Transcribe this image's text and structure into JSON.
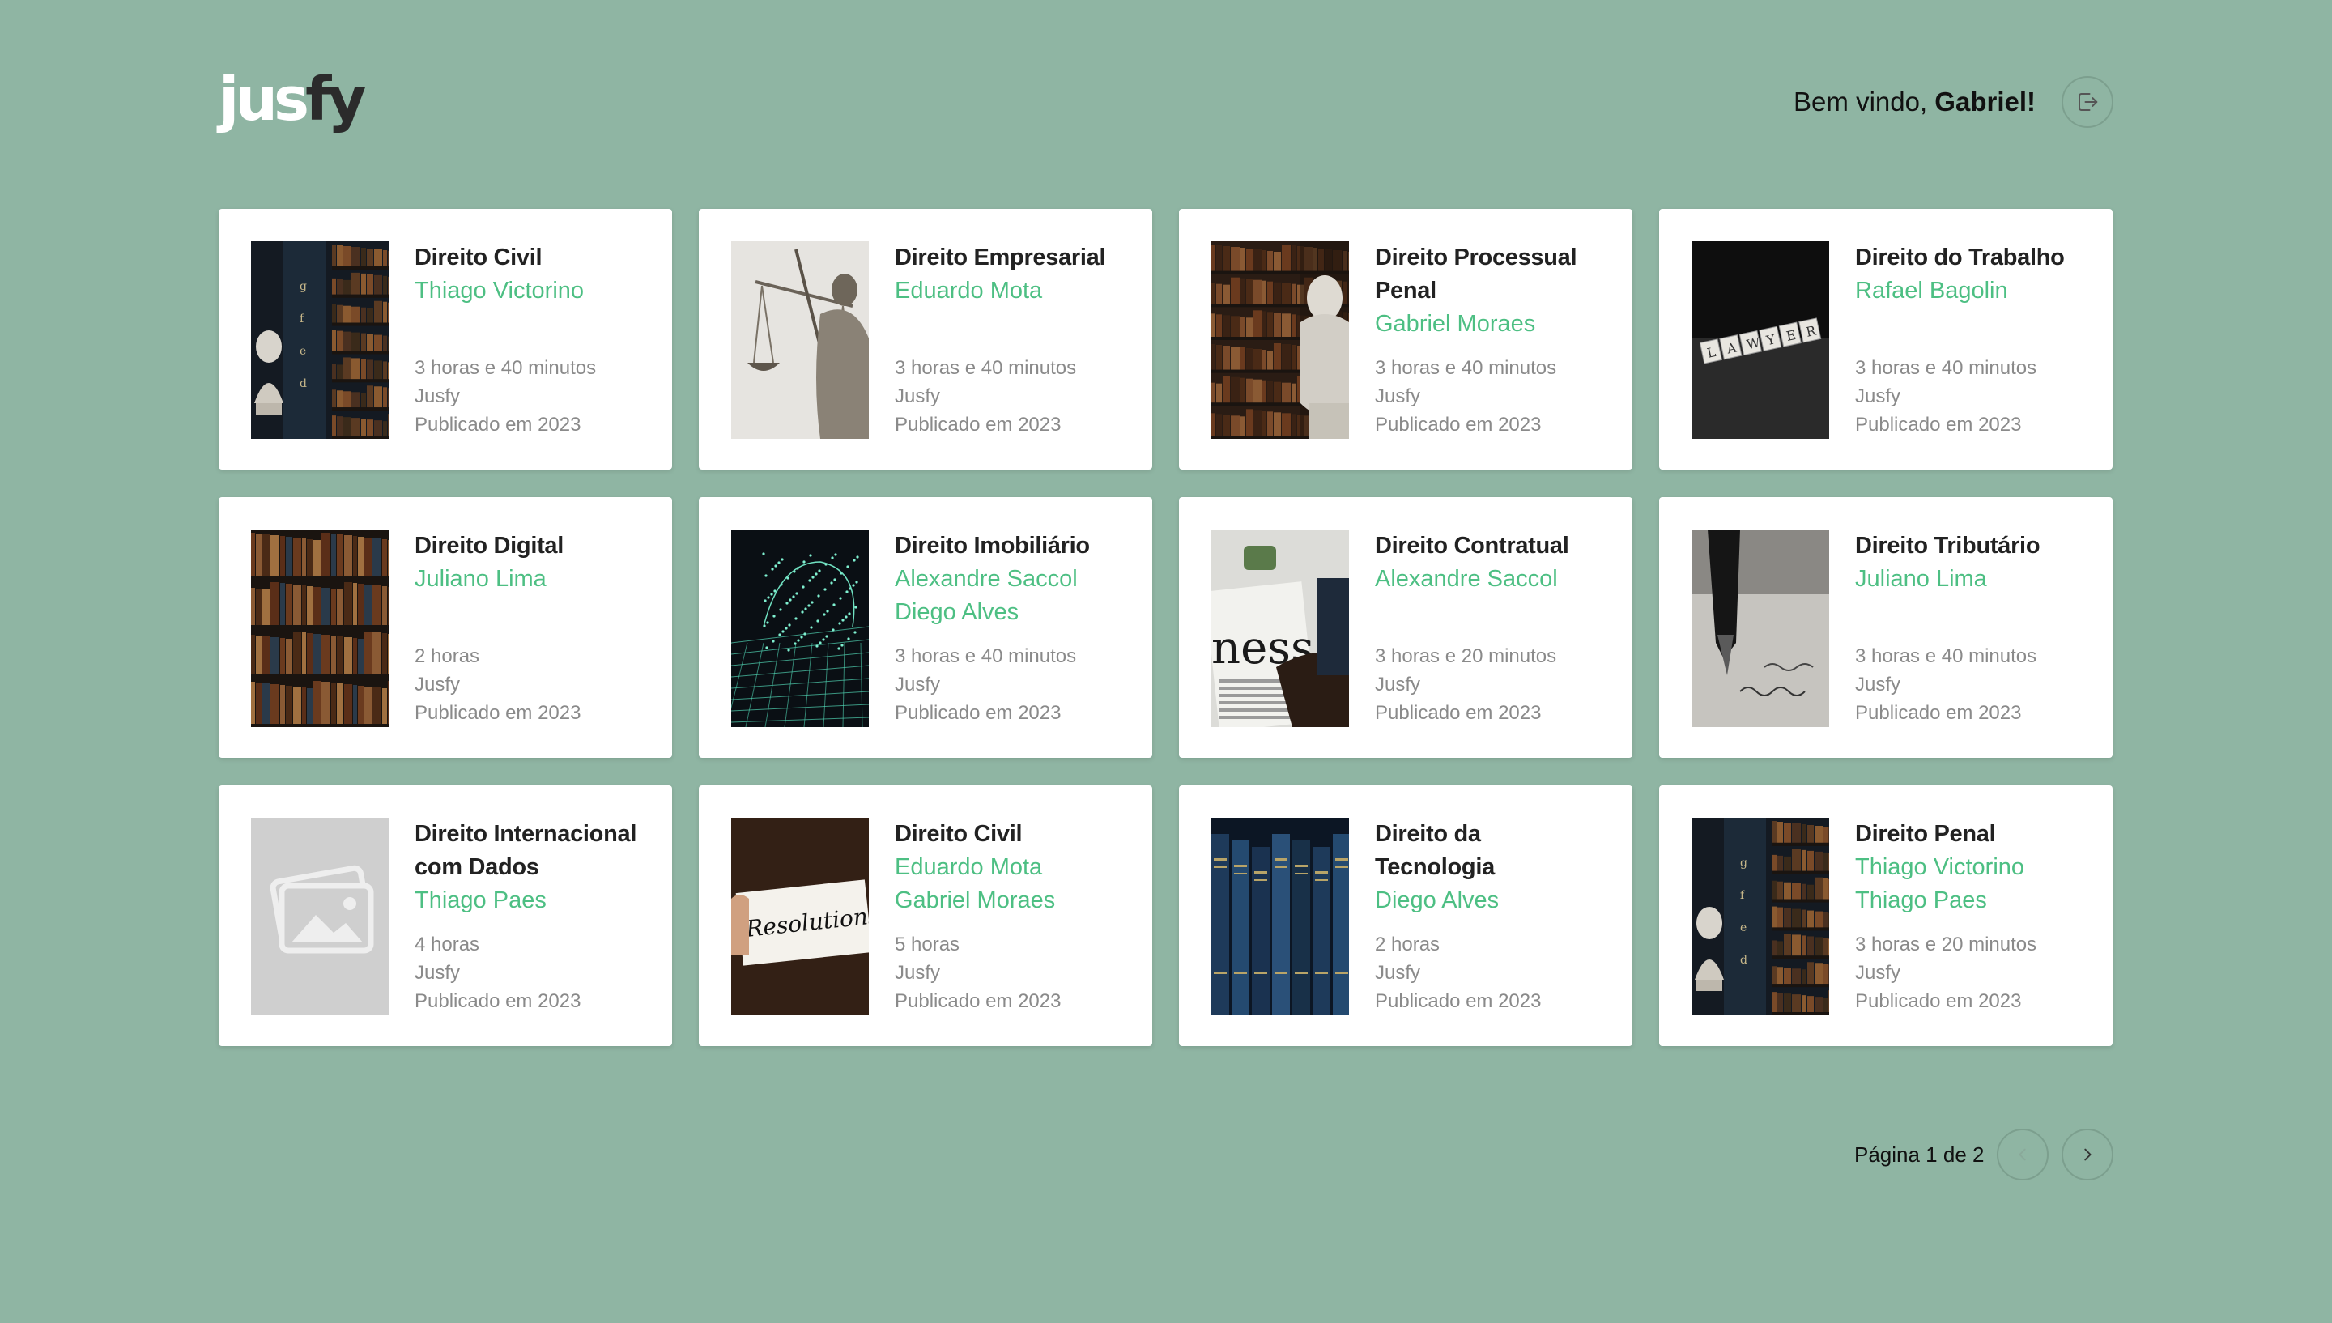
{
  "header": {
    "logo_part1": "jus",
    "logo_part2": "fy",
    "welcome_prefix": "Bem vindo, ",
    "user_name": "Gabriel!",
    "logout_icon": "logout-icon"
  },
  "courses": [
    {
      "title": "Direito Civil",
      "authors": [
        "Thiago Victorino"
      ],
      "duration": "3 horas e 40 minutos",
      "publisher": "Jusfy",
      "published": "Publicado em 2023",
      "thumb": "library-bust"
    },
    {
      "title": "Direito Empresarial",
      "authors": [
        "Eduardo Mota"
      ],
      "duration": "3 horas e 40 minutos",
      "publisher": "Jusfy",
      "published": "Publicado em 2023",
      "thumb": "justice-statue"
    },
    {
      "title": "Direito Processual Penal",
      "authors": [
        "Gabriel Moraes"
      ],
      "duration": "3 horas e 40 minutos",
      "publisher": "Jusfy",
      "published": "Publicado em 2023",
      "thumb": "bust-books"
    },
    {
      "title": "Direito do Trabalho",
      "authors": [
        "Rafael Bagolin"
      ],
      "duration": "3 horas e 40 minutos",
      "publisher": "Jusfy",
      "published": "Publicado em 2023",
      "thumb": "lawyer-tiles"
    },
    {
      "title": "Direito Digital",
      "authors": [
        "Juliano Lima"
      ],
      "duration": "2 horas",
      "publisher": "Jusfy",
      "published": "Publicado em 2023",
      "thumb": "bookshelf"
    },
    {
      "title": "Direito Imobiliário",
      "authors": [
        "Alexandre Saccol",
        "Diego Alves"
      ],
      "duration": "3 horas e 40 minutos",
      "publisher": "Jusfy",
      "published": "Publicado em 2023",
      "thumb": "digital-mesh"
    },
    {
      "title": "Direito Contratual",
      "authors": [
        "Alexandre Saccol"
      ],
      "duration": "3 horas e 20 minutos",
      "publisher": "Jusfy",
      "published": "Publicado em 2023",
      "thumb": "newspaper"
    },
    {
      "title": "Direito Tributário",
      "authors": [
        "Juliano Lima"
      ],
      "duration": "3 horas e 40 minutos",
      "publisher": "Jusfy",
      "published": "Publicado em 2023",
      "thumb": "fountain-pen"
    },
    {
      "title": "Direito Internacional com Dados",
      "authors": [
        "Thiago Paes"
      ],
      "duration": "4 horas",
      "publisher": "Jusfy",
      "published": "Publicado em 2023",
      "thumb": "placeholder"
    },
    {
      "title": "Direito Civil",
      "authors": [
        "Eduardo Mota",
        "Gabriel Moraes"
      ],
      "duration": "5 horas",
      "publisher": "Jusfy",
      "published": "Publicado em 2023",
      "thumb": "resolutions-note",
      "thumb_text": "Resolutions"
    },
    {
      "title": "Direito da Tecnologia",
      "authors": [
        "Diego Alves"
      ],
      "duration": "2 horas",
      "publisher": "Jusfy",
      "published": "Publicado em 2023",
      "thumb": "blue-books"
    },
    {
      "title": "Direito Penal",
      "authors": [
        "Thiago Victorino",
        "Thiago Paes"
      ],
      "duration": "3 horas e 20 minutos",
      "publisher": "Jusfy",
      "published": "Publicado em 2023",
      "thumb": "library-bust"
    }
  ],
  "pagination": {
    "label": "Página 1 de 2",
    "prev_icon": "chevron-left-icon",
    "next_icon": "chevron-right-icon"
  },
  "colors": {
    "background": "#8fb5a3",
    "accent": "#4dbf83",
    "card": "#ffffff"
  }
}
